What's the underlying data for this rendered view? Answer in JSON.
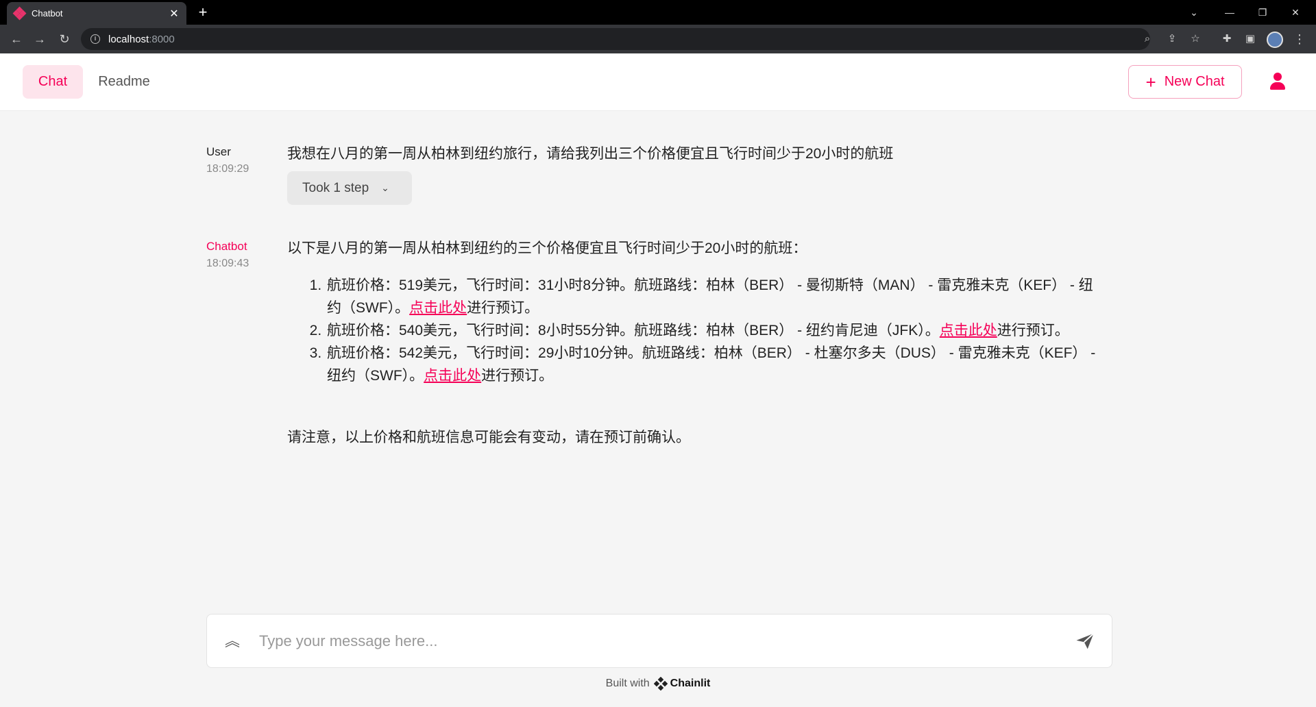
{
  "browser": {
    "tab_title": "Chatbot",
    "url_host": "localhost",
    "url_port": ":8000"
  },
  "header": {
    "nav_chat": "Chat",
    "nav_readme": "Readme",
    "new_chat": "New Chat"
  },
  "messages": [
    {
      "author": "User",
      "time": "18:09:29",
      "text": "我想在八月的第一周从柏林到纽约旅行，请给我列出三个价格便宜且飞行时间少于20小时的航班",
      "step_label": "Took 1 step"
    },
    {
      "author": "Chatbot",
      "time": "18:09:43",
      "intro": "以下是八月的第一周从柏林到纽约的三个价格便宜且飞行时间少于20小时的航班：",
      "items": [
        {
          "text": "航班价格：519美元，飞行时间：31小时8分钟。航班路线：柏林（BER） - 曼彻斯特（MAN） - 雷克雅未克（KEF） - 纽约（SWF）。",
          "link": "点击此处",
          "tail": "进行预订。"
        },
        {
          "text": "航班价格：540美元，飞行时间：8小时55分钟。航班路线：柏林（BER） - 纽约肯尼迪（JFK）。",
          "link": "点击此处",
          "tail": "进行预订。"
        },
        {
          "text": "航班价格：542美元，飞行时间：29小时10分钟。航班路线：柏林（BER） - 杜塞尔多夫（DUS） - 雷克雅未克（KEF） - 纽约（SWF）。",
          "link": "点击此处",
          "tail": "进行预订。"
        }
      ],
      "note": "请注意，以上价格和航班信息可能会有变动，请在预订前确认。"
    }
  ],
  "composer": {
    "placeholder": "Type your message here..."
  },
  "footer": {
    "built_with": "Built with",
    "brand": "Chainlit"
  },
  "colors": {
    "accent": "#f50057",
    "accent_light": "#fde4ec",
    "background": "#f5f5f5"
  }
}
